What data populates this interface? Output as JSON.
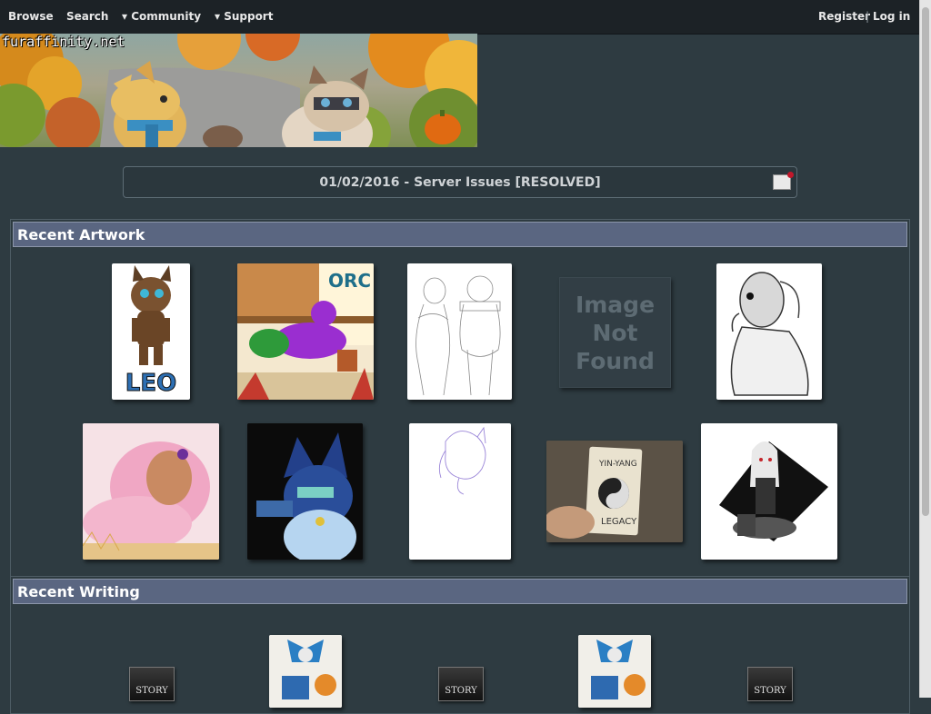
{
  "nav": {
    "browse": "Browse",
    "search": "Search",
    "community": "▾ Community",
    "support": "▾ Support",
    "register": "Register",
    "separator": "|",
    "login": "Log in"
  },
  "banner": {
    "logo_text": "furaffinity.net"
  },
  "notice": {
    "text": "01/02/2016 - Server Issues [RESOLVED]"
  },
  "recent_artwork": {
    "title": "Recent Artwork",
    "image_not_found": [
      "Image",
      "Not",
      "Found"
    ]
  },
  "recent_writing": {
    "title": "Recent Writing",
    "story_label": "STORY"
  },
  "colors": {
    "background": "#2e3b41",
    "topbar": "#1c2226",
    "section_header": "#5a6681"
  }
}
